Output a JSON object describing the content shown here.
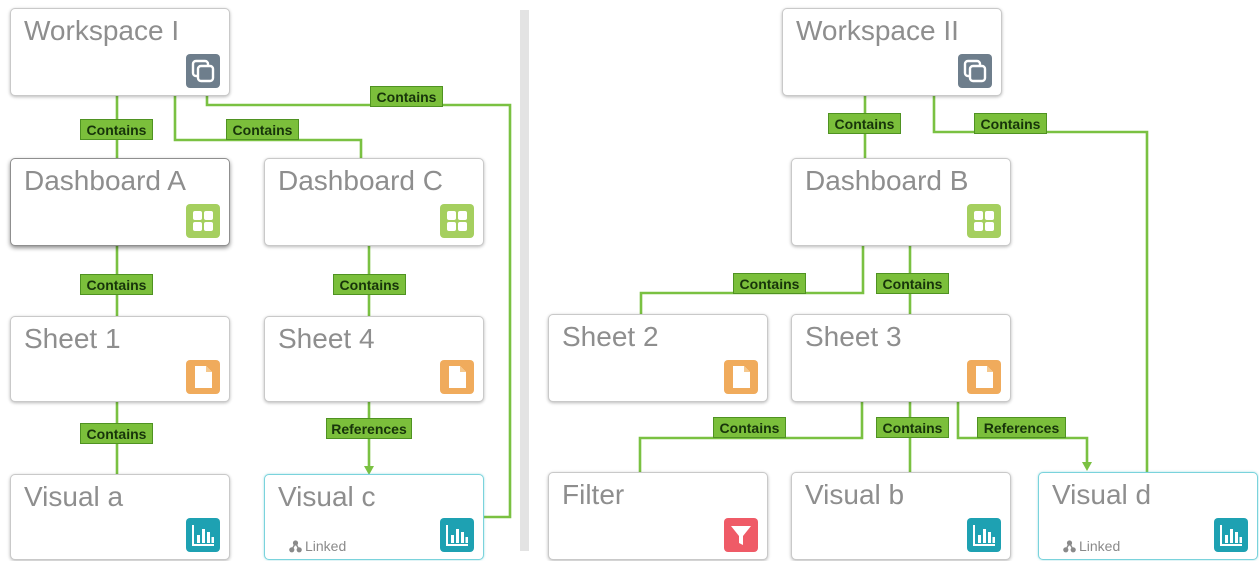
{
  "nodes": [
    {
      "key": "workspace-1",
      "title": "Workspace I",
      "icon": "workspace-icon"
    },
    {
      "key": "dashboard-a",
      "title": "Dashboard A",
      "icon": "dashboard-icon"
    },
    {
      "key": "dashboard-c",
      "title": "Dashboard C",
      "icon": "dashboard-icon"
    },
    {
      "key": "sheet-1",
      "title": "Sheet 1",
      "icon": "sheet-icon"
    },
    {
      "key": "sheet-4",
      "title": "Sheet 4",
      "icon": "sheet-icon"
    },
    {
      "key": "visual-a",
      "title": "Visual a",
      "icon": "visual-chart-icon"
    },
    {
      "key": "visual-c",
      "title": "Visual c",
      "icon": "visual-chart-icon",
      "tag": "Linked"
    },
    {
      "key": "workspace-2",
      "title": "Workspace II",
      "icon": "workspace-icon"
    },
    {
      "key": "dashboard-b",
      "title": "Dashboard B",
      "icon": "dashboard-icon"
    },
    {
      "key": "sheet-2",
      "title": "Sheet 2",
      "icon": "sheet-icon"
    },
    {
      "key": "sheet-3",
      "title": "Sheet 3",
      "icon": "sheet-icon"
    },
    {
      "key": "filter",
      "title": "Filter",
      "icon": "filter-icon"
    },
    {
      "key": "visual-b",
      "title": "Visual b",
      "icon": "visual-chart-icon"
    },
    {
      "key": "visual-d",
      "title": "Visual d",
      "icon": "visual-chart-icon",
      "tag": "Linked"
    }
  ],
  "edges": [
    {
      "from": "workspace-1",
      "to": "dashboard-a",
      "label": "Contains"
    },
    {
      "from": "workspace-1",
      "to": "dashboard-c",
      "label": "Contains"
    },
    {
      "from": "workspace-1",
      "to": "visual-c",
      "label": "Contains"
    },
    {
      "from": "dashboard-a",
      "to": "sheet-1",
      "label": "Contains"
    },
    {
      "from": "dashboard-c",
      "to": "sheet-4",
      "label": "Contains"
    },
    {
      "from": "sheet-1",
      "to": "visual-a",
      "label": "Contains"
    },
    {
      "from": "sheet-4",
      "to": "visual-c",
      "label": "References"
    },
    {
      "from": "workspace-2",
      "to": "dashboard-b",
      "label": "Contains"
    },
    {
      "from": "workspace-2",
      "to": "visual-d",
      "label": "Contains"
    },
    {
      "from": "dashboard-b",
      "to": "sheet-2",
      "label": "Contains"
    },
    {
      "from": "dashboard-b",
      "to": "sheet-3",
      "label": "Contains"
    },
    {
      "from": "sheet-3",
      "to": "filter",
      "label": "Contains"
    },
    {
      "from": "sheet-3",
      "to": "visual-b",
      "label": "Contains"
    },
    {
      "from": "sheet-3",
      "to": "visual-d",
      "label": "References"
    }
  ],
  "colors": {
    "edge_line": "#7ac142",
    "label_fill": "#7bbf3b",
    "workspace_icon": "#6e7e8c",
    "dashboard_icon": "#a5cf5f",
    "sheet_icon": "#f0ab5c",
    "visual_icon": "#1ea1b2",
    "filter_icon": "#ef5b67"
  }
}
